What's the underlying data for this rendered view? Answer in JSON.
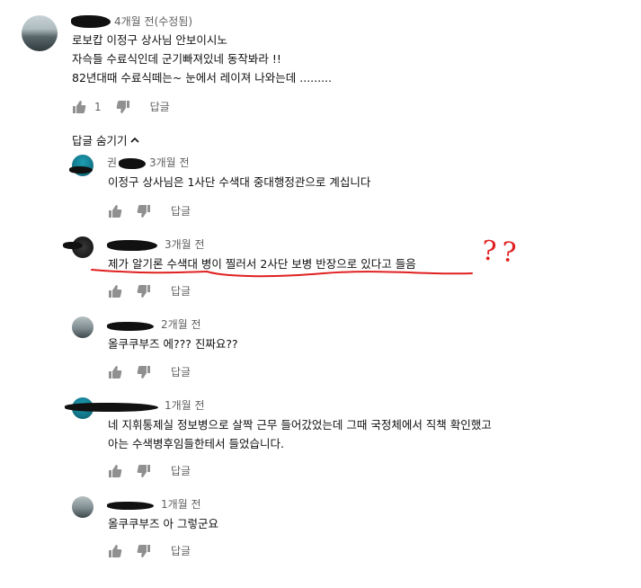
{
  "main_comment": {
    "avatar": "profile-photo",
    "time": "4개월 전(수정됨)",
    "lines": [
      "로보캅 이정구 상사님 안보이시노",
      "자슥들 수료식인데 군기빠져있네 동작봐라 !!",
      "82년대때 수료식떼는~ 눈에서 레이져 나와는데 ........."
    ],
    "like_count": "1",
    "reply_label": "답글"
  },
  "hide_replies": {
    "label": "답글 숨기기",
    "icon": "chevron-up-icon"
  },
  "replies": [
    {
      "author_visible": "권",
      "time": "3개월 전",
      "lines": [
        "이정구 상사님은 1사단 수색대 중대행정관으로 계십니다"
      ],
      "reply_label": "답글"
    },
    {
      "time": "3개월 전",
      "lines": [
        "제가 알기론 수색대 병이 찔러서 2사단 보병 반장으로 있다고 들음"
      ],
      "reply_label": "답글",
      "annotation": "??"
    },
    {
      "time": "2개월 전",
      "lines": [
        "올쿠쿠부즈 에??? 진짜요??"
      ],
      "reply_label": "답글"
    },
    {
      "time": "1개월 전",
      "lines": [
        "네 지휘통제실 정보병으로 살짝 근무 들어갔었는데 그때 국정체에서 직책 확인했고",
        "아는 수색병후임들한테서 들었습니다."
      ],
      "reply_label": "답글"
    },
    {
      "time": "1개월 전",
      "lines": [
        "올쿠쿠부즈 아 그렇군요"
      ],
      "reply_label": "답글"
    }
  ],
  "colors": {
    "meta_gray": "#606060",
    "text": "#0f0f0f",
    "annotation_red": "#e02020"
  }
}
